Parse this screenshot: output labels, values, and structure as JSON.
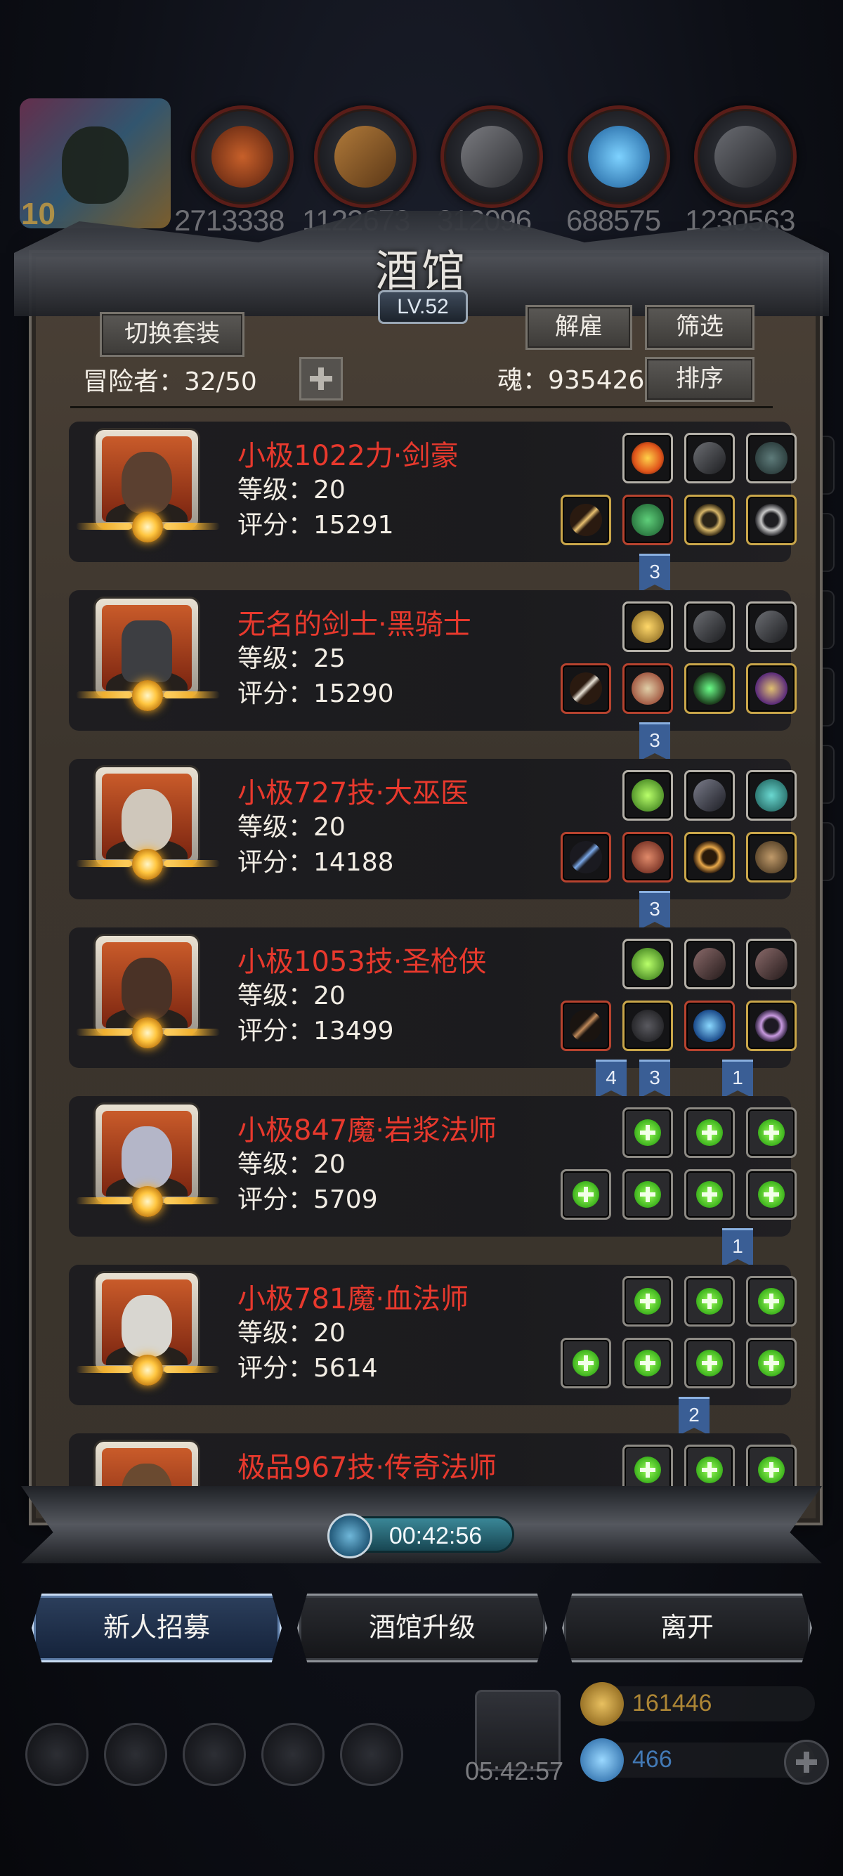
{
  "top_bar": {
    "player_level": "10",
    "resources": [
      {
        "name": "meat",
        "amount": "2713338",
        "color": "#a64a20"
      },
      {
        "name": "wood",
        "amount": "1122673",
        "color": "#8a5a2a"
      },
      {
        "name": "stone",
        "amount": "312096",
        "color": "#5a5a5e"
      },
      {
        "name": "crystal",
        "amount": "688575",
        "color": "#3a9ad8"
      },
      {
        "name": "iron",
        "amount": "1230563",
        "color": "#4a4c52"
      }
    ]
  },
  "tavern": {
    "title": "酒馆",
    "level": "LV.52",
    "switch_outfit_label": "切换套装",
    "dismiss_label": "解雇",
    "filter_label": "筛选",
    "sort_label": "排序",
    "adventurers_label": "冒险者：32/50",
    "soul_label": "魂：935426"
  },
  "heroes": [
    {
      "name": "小极1022力·剑豪",
      "level": "等级：20",
      "score": "评分：15291",
      "portrait": "#5b4030"
    },
    {
      "name": "无名的剑士·黑骑士",
      "level": "等级：25",
      "score": "评分：15290",
      "portrait": "#3d3e42"
    },
    {
      "name": "小极727技·大巫医",
      "level": "等级：20",
      "score": "评分：14188",
      "portrait": "#cfc7bb"
    },
    {
      "name": "小极1053技·圣枪侠",
      "level": "等级：20",
      "score": "评分：13499",
      "portrait": "#4a3226"
    },
    {
      "name": "小极847魔·岩浆法师",
      "level": "等级：20",
      "score": "评分：5709",
      "portrait": "#b4b6c8"
    },
    {
      "name": "小极781魔·血法师",
      "level": "等级：20",
      "score": "评分：5614",
      "portrait": "#d8d6d0"
    },
    {
      "name": "极品967技·传奇法师",
      "level": "",
      "score": "",
      "portrait": "#6a4a30"
    }
  ],
  "tags": {
    "t1": "3",
    "t2": "3",
    "t3": "3",
    "t4a": "4",
    "t4b": "3",
    "t4c": "1",
    "t5": "1",
    "t6": "2"
  },
  "timer": "00:42:56",
  "bottom_buttons": {
    "recruit": "新人招募",
    "upgrade": "酒馆升级",
    "leave": "离开"
  },
  "hud": {
    "gift_timer": "05:42:57",
    "gold": "161446",
    "gems": "466"
  }
}
